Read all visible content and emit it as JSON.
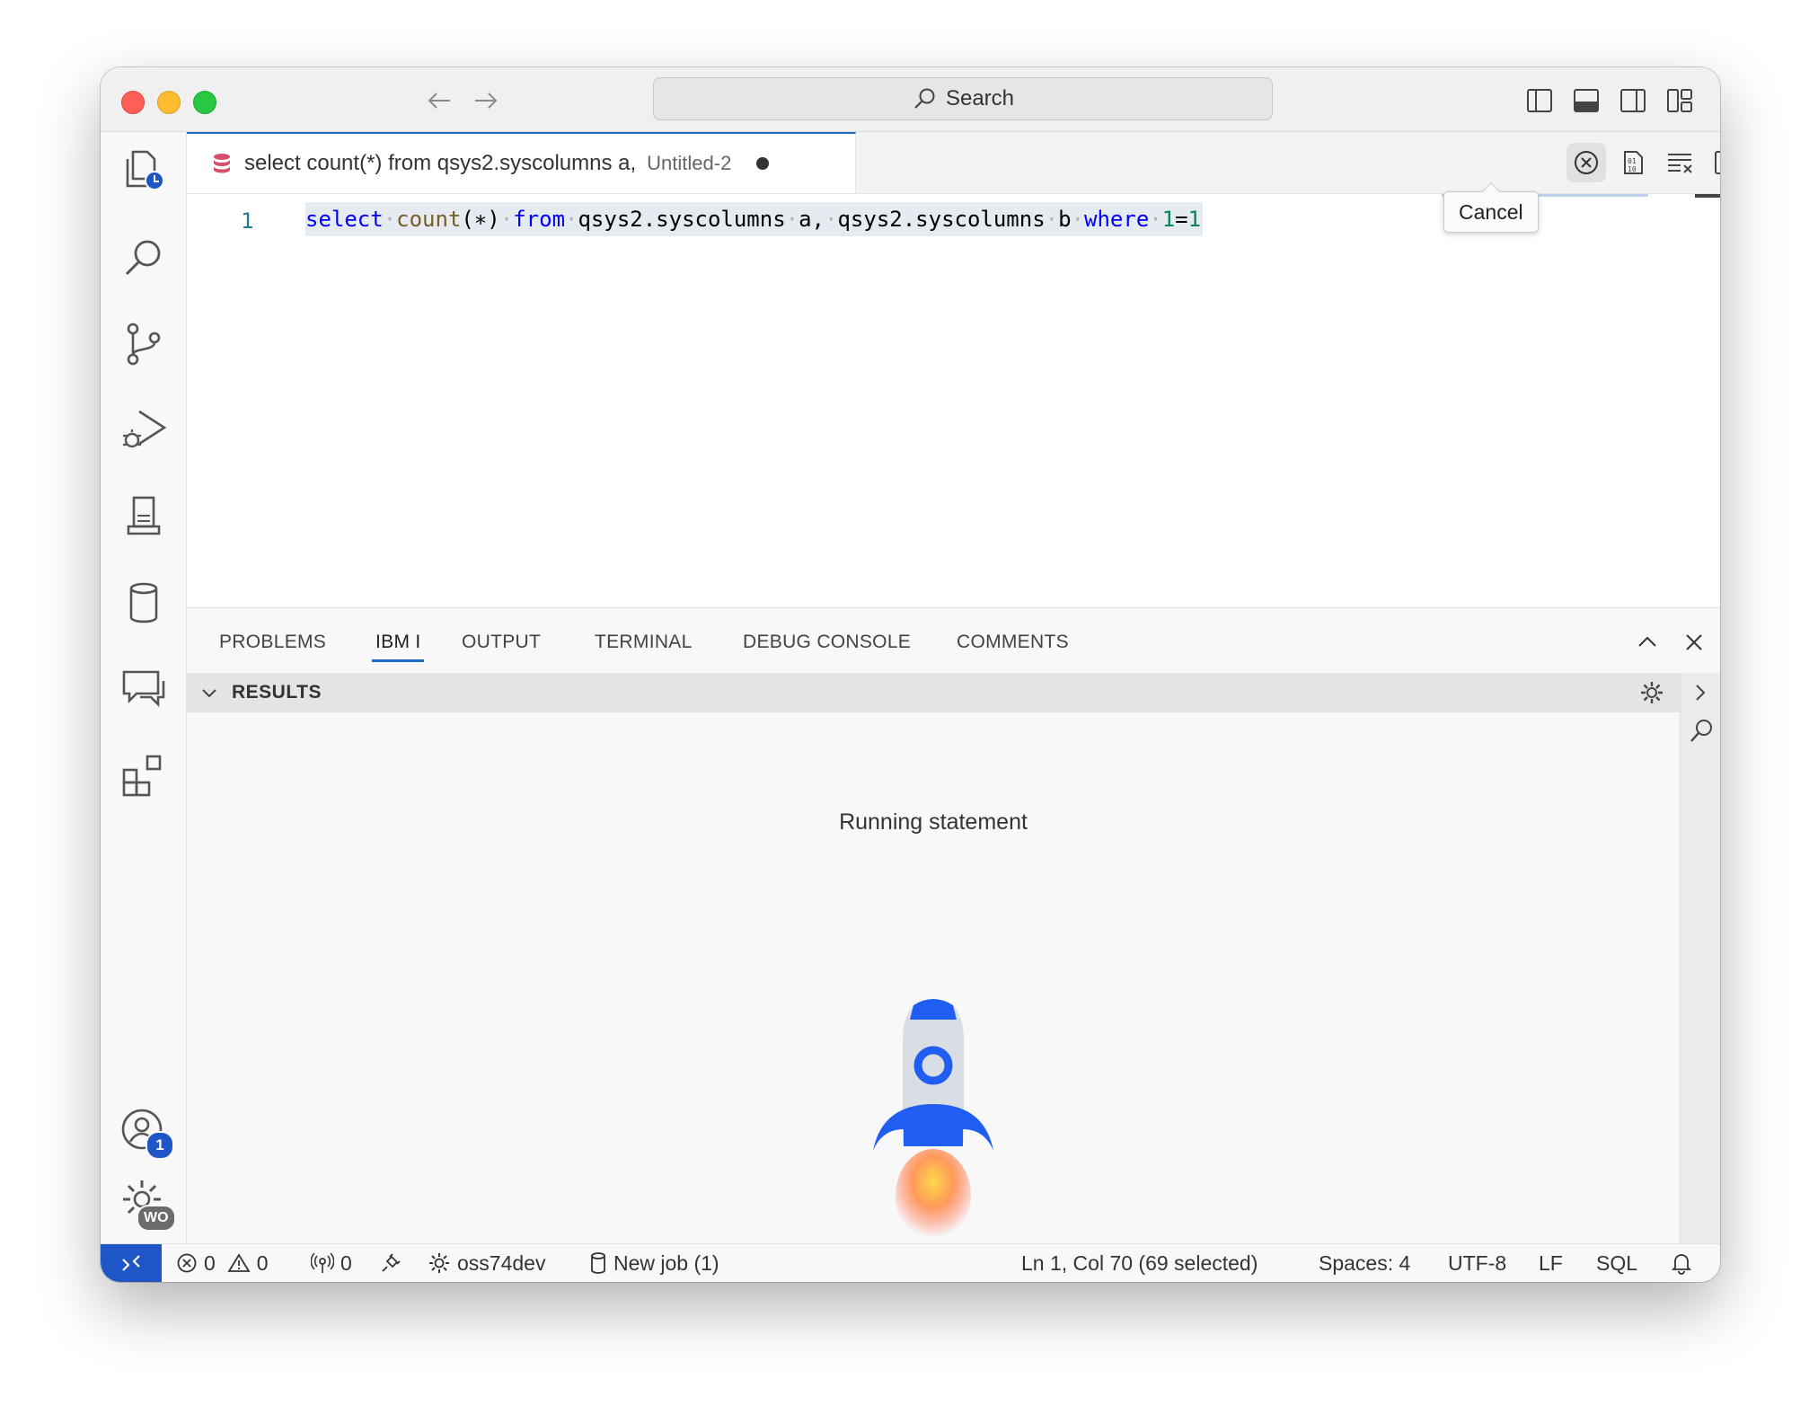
{
  "titlebar": {
    "search_label": "Search"
  },
  "activity_bar": {
    "accounts_badge": "1",
    "manage_badge": "WO"
  },
  "tab": {
    "title": "select count(*) from qsys2.syscolumns a,",
    "description": "Untitled-2"
  },
  "tooltip": {
    "label": "Cancel"
  },
  "editor": {
    "line_number": "1",
    "tokens": {
      "t1": "select",
      "t2": "count",
      "t3": "(∗)",
      "t4": "from",
      "t5": "qsys2.syscolumns",
      "t6": "a,",
      "t7": "qsys2.syscolumns",
      "t8": "b",
      "t9": "where",
      "t10": "1",
      "t11": "=",
      "t12": "1"
    }
  },
  "panel": {
    "tabs": [
      "PROBLEMS",
      "IBM I",
      "OUTPUT",
      "TERMINAL",
      "DEBUG CONSOLE",
      "COMMENTS"
    ],
    "active_tab": "IBM I",
    "results_title": "RESULTS",
    "status_message": "Running statement"
  },
  "statusbar": {
    "errors": "0",
    "warnings": "0",
    "ports": "0",
    "connection": "oss74dev",
    "job": "New job (1)",
    "cursor": "Ln 1, Col 70 (69 selected)",
    "spaces": "Spaces: 4",
    "encoding": "UTF-8",
    "eol": "LF",
    "language": "SQL"
  },
  "colors": {
    "accent": "#1e6cc8",
    "remote_indicator": "#1e56c7",
    "rocket_body": "#d9dde4",
    "rocket_blue": "#1f5ef0",
    "tab_db_icon": "#d6506b"
  },
  "icons": {
    "activity": [
      "explorer-timeline-icon",
      "search-icon",
      "source-control-icon",
      "run-debug-icon",
      "ibmi-server-icon",
      "database-icon",
      "notebook-chat-icon",
      "extensions-icon",
      "accounts-icon",
      "manage-gear-icon"
    ],
    "editor_actions": [
      "cancel-circle-icon",
      "binary-file-icon",
      "clear-format-icon",
      "split-editor-icon",
      "more-actions-icon"
    ]
  }
}
